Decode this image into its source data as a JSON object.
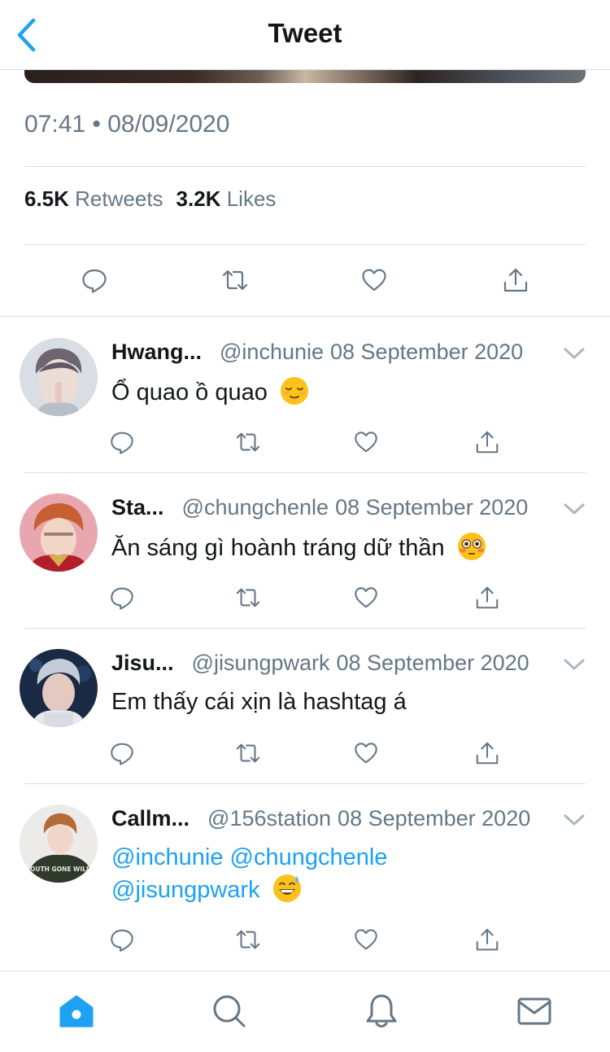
{
  "header": {
    "title": "Tweet",
    "back_icon": "chevron-left-icon",
    "accent": "#1da1f2"
  },
  "tweet": {
    "timestamp": "07:41 • 08/09/2020",
    "retweets_count": "6.5K",
    "retweets_label": "Retweets",
    "likes_count": "3.2K",
    "likes_label": "Likes",
    "actions": [
      "reply-icon",
      "retweet-icon",
      "like-icon",
      "share-icon"
    ]
  },
  "replies": [
    {
      "name": "Hwang...",
      "handle": "@inchunie",
      "date": "08 September 2020",
      "text": "Ổ quao ồ quao",
      "emoji": "relieved-face-emoji"
    },
    {
      "name": "Sta...",
      "handle": "@chungchenle",
      "date": "08 September 2020",
      "text": "Ăn sáng gì hoành tráng dữ thần",
      "emoji": "flushed-face-emoji"
    },
    {
      "name": "Jisu...",
      "handle": "@jisungpwark",
      "date": "08 September 2020",
      "text": "Em thấy cái xịn là hashtag á",
      "emoji": ""
    },
    {
      "name": "Callm...",
      "handle": "@156station",
      "date": "08 September 2020",
      "mention_1": "@inchunie",
      "mention_2": "@chungchenle",
      "mention_3": "@jisungpwark",
      "emoji": "grinning-sweat-face-emoji",
      "avatar_text": "YOUTH GONE WILD"
    }
  ],
  "tabbar": {
    "items": [
      "home-icon",
      "search-icon",
      "notifications-icon",
      "messages-icon"
    ],
    "active": "home-icon"
  }
}
